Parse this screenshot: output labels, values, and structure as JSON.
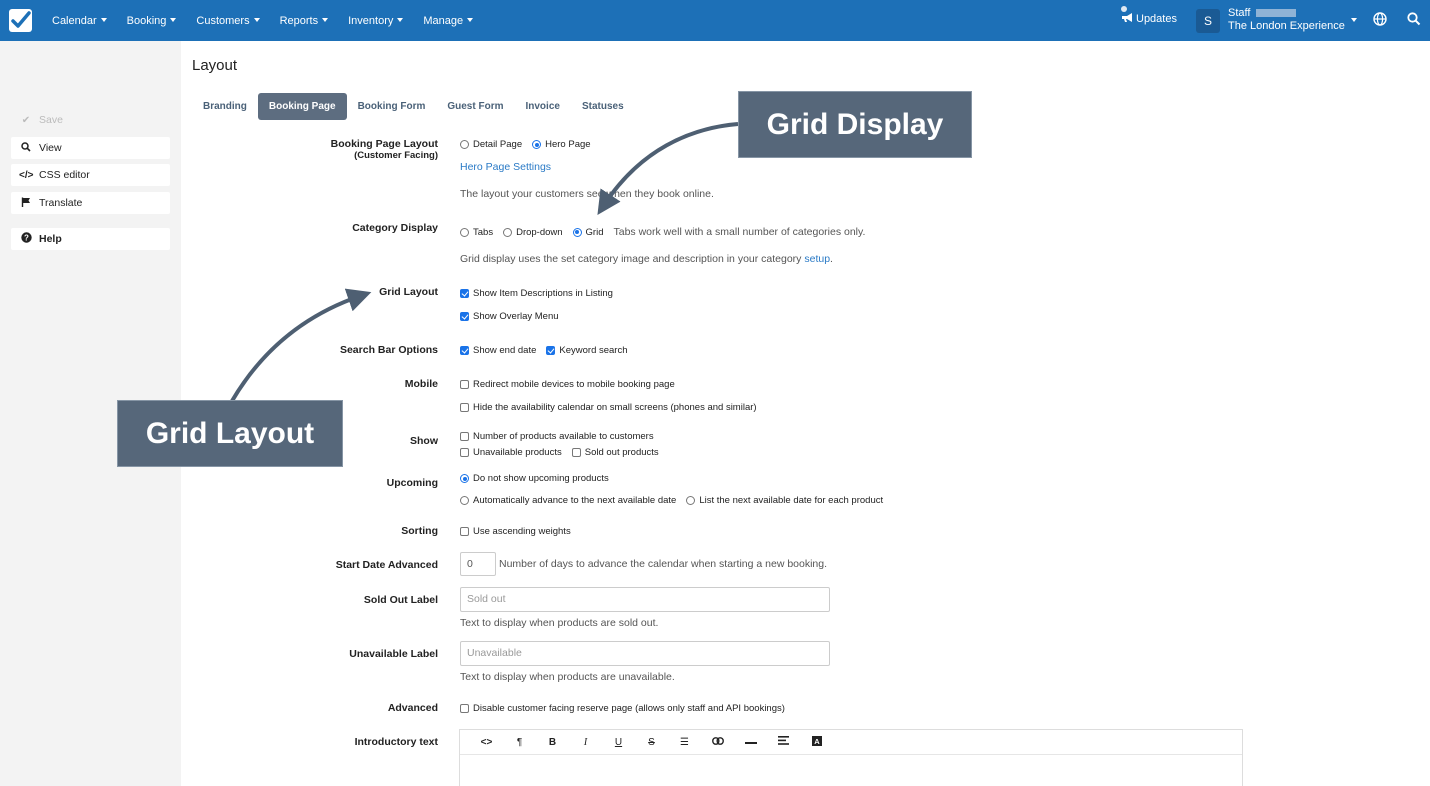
{
  "nav": {
    "items": [
      "Calendar",
      "Booking",
      "Customers",
      "Reports",
      "Inventory",
      "Manage"
    ],
    "updates_label": "Updates",
    "user_initial": "S",
    "user_role": "Staff",
    "company": "The London Experience"
  },
  "sidebar": {
    "save": "Save",
    "view": "View",
    "css_editor": "CSS editor",
    "translate": "Translate",
    "help": "Help"
  },
  "page": {
    "title": "Layout",
    "tabs": [
      "Branding",
      "Booking Page",
      "Booking Form",
      "Guest Form",
      "Invoice",
      "Statuses"
    ]
  },
  "form": {
    "booking_layout": {
      "label": "Booking Page Layout",
      "sublabel": "(Customer Facing)",
      "opt_detail": "Detail Page",
      "opt_hero": "Hero Page",
      "hero_link": "Hero Page Settings",
      "help": "The layout your customers see when they book online."
    },
    "category_display": {
      "label": "Category Display",
      "opt_tabs": "Tabs",
      "opt_dropdown": "Drop-down",
      "opt_grid": "Grid",
      "note": "Tabs work well with a small number of categories only.",
      "help_text": "Grid display uses the set category image and description in your category",
      "help_link": "setup",
      "help_end": "."
    },
    "grid_layout": {
      "label": "Grid Layout",
      "opt_descriptions": "Show Item Descriptions in Listing",
      "opt_overlay": "Show Overlay Menu"
    },
    "search_bar": {
      "label": "Search Bar Options",
      "opt_end_date": "Show end date",
      "opt_keyword": "Keyword search"
    },
    "mobile": {
      "label": "Mobile",
      "opt_redirect": "Redirect mobile devices to mobile booking page",
      "opt_hide_calendar": "Hide the availability calendar on small screens (phones and similar)"
    },
    "show": {
      "label": "Show",
      "opt_number": "Number of products available to customers",
      "opt_unavailable": "Unavailable products",
      "opt_soldout": "Sold out products"
    },
    "upcoming": {
      "label": "Upcoming",
      "opt_none": "Do not show upcoming products",
      "opt_advance": "Automatically advance to the next available date",
      "opt_list": "List the next available date for each product"
    },
    "sorting": {
      "label": "Sorting",
      "opt_ascending": "Use ascending weights"
    },
    "start_date": {
      "label": "Start Date Advanced",
      "value": "0",
      "help": "Number of days to advance the calendar when starting a new booking."
    },
    "sold_out_label": {
      "label": "Sold Out Label",
      "placeholder": "Sold out",
      "help": "Text to display when products are sold out."
    },
    "unavailable_label": {
      "label": "Unavailable Label",
      "placeholder": "Unavailable",
      "help": "Text to display when products are unavailable."
    },
    "advanced": {
      "label": "Advanced",
      "opt_disable": "Disable customer facing reserve page (allows only staff and API bookings)"
    },
    "intro_text": {
      "label": "Introductory text"
    }
  },
  "annotations": {
    "grid_display": "Grid Display",
    "grid_layout": "Grid Layout"
  },
  "colors": {
    "topbar": "#1d70b7",
    "callout": "#56677a",
    "link": "#2a7ac6",
    "active_tab": "#5d6d80"
  }
}
